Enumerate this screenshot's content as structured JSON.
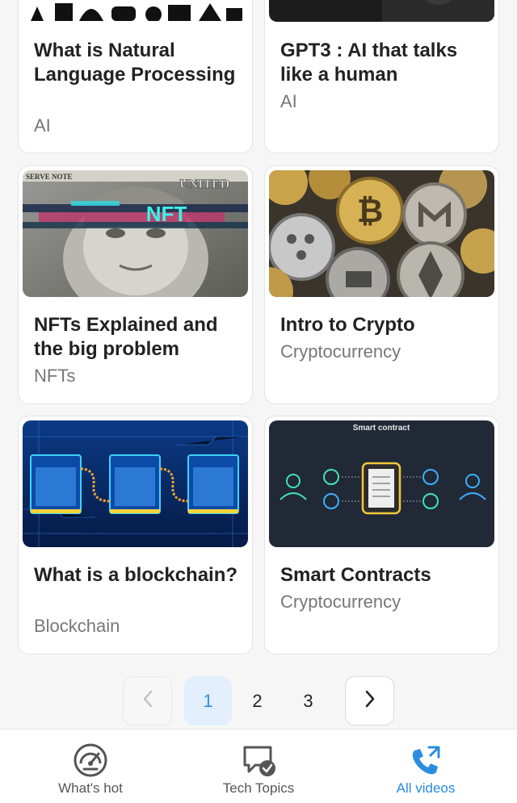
{
  "cards": [
    {
      "title": "What is Natural Language Processing",
      "category": "AI"
    },
    {
      "title": "GPT3 : AI that talks like a human",
      "category": "AI"
    },
    {
      "title": "NFTs Explained and the big problem",
      "category": "NFTs",
      "image_text": "NFT"
    },
    {
      "title": "Intro to Crypto",
      "category": "Cryptocurrency"
    },
    {
      "title": "What is a blockchain?",
      "category": "Blockchain"
    },
    {
      "title": "Smart Contracts",
      "category": "Cryptocurrency",
      "image_text": "Smart contract"
    }
  ],
  "pagination": {
    "prev_icon": "chevron-left-icon",
    "next_icon": "chevron-right-icon",
    "pages": [
      "1",
      "2",
      "3"
    ],
    "current": "1"
  },
  "bottom_nav": [
    {
      "label": "What's hot",
      "icon": "speedometer-icon",
      "active": false
    },
    {
      "label": "Tech Topics",
      "icon": "chat-check-icon",
      "active": false
    },
    {
      "label": "All videos",
      "icon": "phone-call-icon",
      "active": true
    }
  ],
  "colors": {
    "accent": "#2a8de0",
    "active_page_bg": "#e3effc",
    "card_border": "#e4e4e6",
    "background": "#f6f6f7"
  }
}
